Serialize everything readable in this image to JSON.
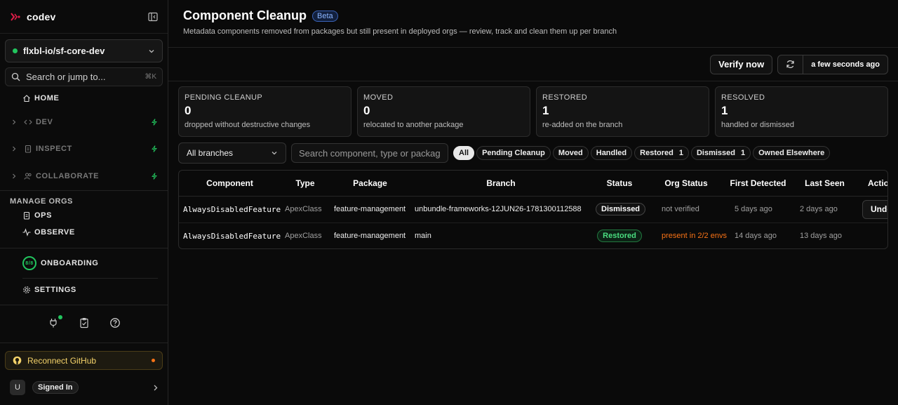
{
  "brand": {
    "name": "codev"
  },
  "sidebar": {
    "org": "flxbl-io/sf-core-dev",
    "search_placeholder": "Search or jump to...",
    "search_shortcut": "⌘K",
    "home": "HOME",
    "groups": [
      {
        "label": "DEV"
      },
      {
        "label": "INSPECT"
      },
      {
        "label": "COLLABORATE"
      }
    ],
    "manage_orgs_label": "MANAGE ORGS",
    "ops": "OPS",
    "observe": "OBSERVE",
    "onboarding": "ONBOARDING",
    "onboarding_progress": "8/8",
    "settings": "SETTINGS",
    "reconnect": "Reconnect GitHub",
    "user_initial": "U",
    "signed_in": "Signed In"
  },
  "header": {
    "title": "Component Cleanup",
    "badge": "Beta",
    "subtitle": "Metadata components removed from packages but still present in deployed orgs — review, track and clean them up per branch"
  },
  "toolbar": {
    "verify": "Verify now",
    "last_checked": "a few seconds ago"
  },
  "stats": [
    {
      "label": "PENDING CLEANUP",
      "value": "0",
      "desc": "dropped without destructive changes"
    },
    {
      "label": "MOVED",
      "value": "0",
      "desc": "relocated to another package"
    },
    {
      "label": "RESTORED",
      "value": "1",
      "desc": "re-added on the branch"
    },
    {
      "label": "RESOLVED",
      "value": "1",
      "desc": "handled or dismissed"
    }
  ],
  "filters": {
    "branch": "All branches",
    "search_placeholder": "Search component, type or package",
    "chips": [
      {
        "label": "All",
        "count": ""
      },
      {
        "label": "Pending Cleanup",
        "count": ""
      },
      {
        "label": "Moved",
        "count": ""
      },
      {
        "label": "Handled",
        "count": ""
      },
      {
        "label": "Restored",
        "count": "1"
      },
      {
        "label": "Dismissed",
        "count": "1"
      },
      {
        "label": "Owned Elsewhere",
        "count": ""
      }
    ]
  },
  "table": {
    "columns": [
      "Component",
      "Type",
      "Package",
      "Branch",
      "Status",
      "Org Status",
      "First Detected",
      "Last Seen",
      "Actions"
    ],
    "rows": [
      {
        "component": "AlwaysDisabledFeature",
        "type": "ApexClass",
        "package": "feature-management",
        "branch": "unbundle-frameworks-12JUN26-1781300112588",
        "status": "Dismissed",
        "org_status": "not verified",
        "first_detected": "5 days ago",
        "last_seen": "2 days ago",
        "action": "Undo dismiss"
      },
      {
        "component": "AlwaysDisabledFeature",
        "type": "ApexClass",
        "package": "feature-management",
        "branch": "main",
        "status": "Restored",
        "org_status": "present in 2/2 envs",
        "first_detected": "14 days ago",
        "last_seen": "13 days ago",
        "action": ""
      }
    ]
  },
  "colors": {
    "accent_green": "#22c55e",
    "warn_orange": "#f97316",
    "beta_blue": "#8ab4ff"
  }
}
